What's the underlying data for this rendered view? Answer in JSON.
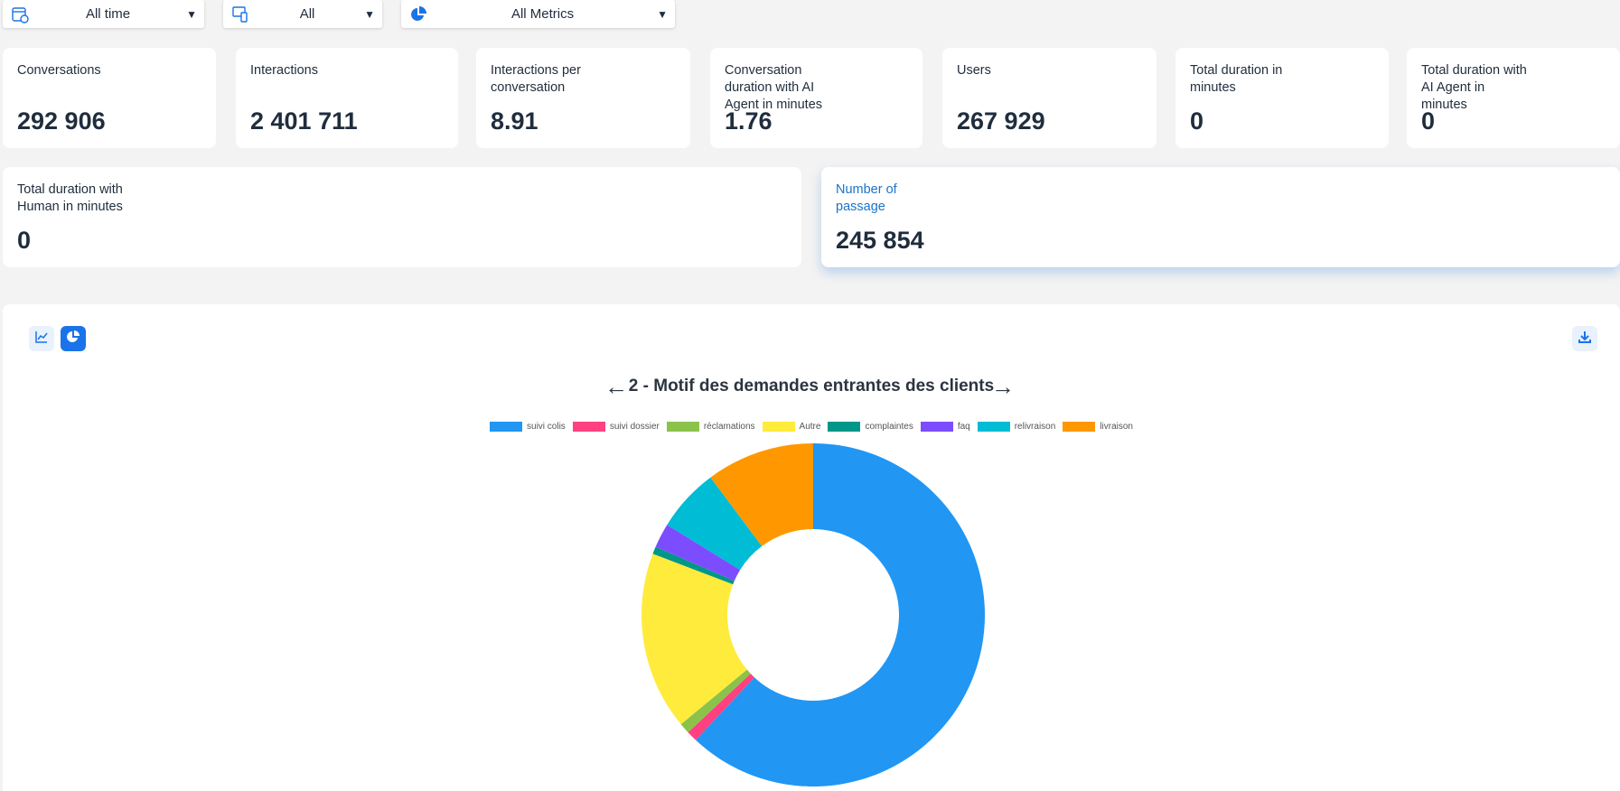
{
  "filters": {
    "time": "All time",
    "channel": "All",
    "metrics": "All Metrics"
  },
  "cards": [
    {
      "label": "Conversations",
      "value": "292 906"
    },
    {
      "label": "Interactions",
      "value": "2 401 711"
    },
    {
      "label": "Interactions per conversation",
      "value": "8.91"
    },
    {
      "label": "Conversation duration with AI Agent in minutes",
      "value": "1.76"
    },
    {
      "label": "Users",
      "value": "267 929"
    },
    {
      "label": "Total duration in minutes",
      "value": "0"
    },
    {
      "label": "Total duration with AI Agent in minutes",
      "value": "0"
    },
    {
      "label": "Total duration with Human in minutes",
      "value": "0"
    },
    {
      "label": "Number of passage",
      "value": "245 854"
    }
  ],
  "chart_nav": {
    "prev": "←",
    "next": "→"
  },
  "chart_data": {
    "type": "pie",
    "title": "2 - Motif des demandes entrantes des clients",
    "labels": [
      "suivi colis",
      "suivi dossier",
      "réclamations",
      "Autre",
      "complaintes",
      "faq",
      "relivraison",
      "livraison"
    ],
    "values": [
      62,
      1,
      1,
      16.8,
      0.7,
      2.3,
      6,
      10.2
    ],
    "colors": [
      "#2196f3",
      "#ff4081",
      "#8bc34a",
      "#ffeb3b",
      "#009688",
      "#7c4dff",
      "#00bcd4",
      "#ff9800"
    ],
    "unit": "percent (estimated)",
    "legend": "top"
  }
}
